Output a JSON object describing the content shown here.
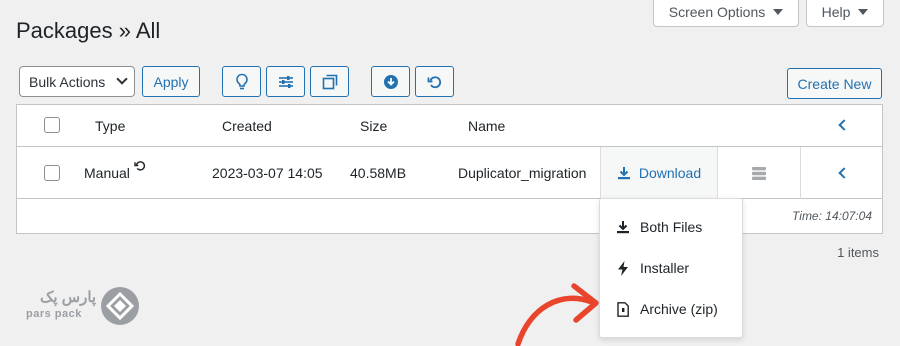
{
  "header": {
    "screen_options_label": "Screen Options",
    "help_label": "Help",
    "page_title": "Packages » All"
  },
  "toolbar": {
    "bulk_actions": "Bulk Actions",
    "apply_label": "Apply",
    "create_new_label": "Create New"
  },
  "table": {
    "columns": [
      "Type",
      "Created",
      "Size",
      "Name"
    ],
    "rows": [
      {
        "type": "Manual",
        "created": "2023-03-07 14:05",
        "size": "40.58MB",
        "name": "Duplicator_migration",
        "download_label": "Download"
      }
    ],
    "footer_time": "Time: 14:07:04"
  },
  "items_count": "1 items",
  "download_menu": {
    "items": [
      "Both Files",
      "Installer",
      "Archive (zip)"
    ]
  },
  "logo": {
    "text": "pars pack",
    "brand_script": "پارس پک"
  },
  "colors": {
    "accent": "#2271b1",
    "arrow": "#e8452c",
    "logo": "#9b9ea3"
  }
}
